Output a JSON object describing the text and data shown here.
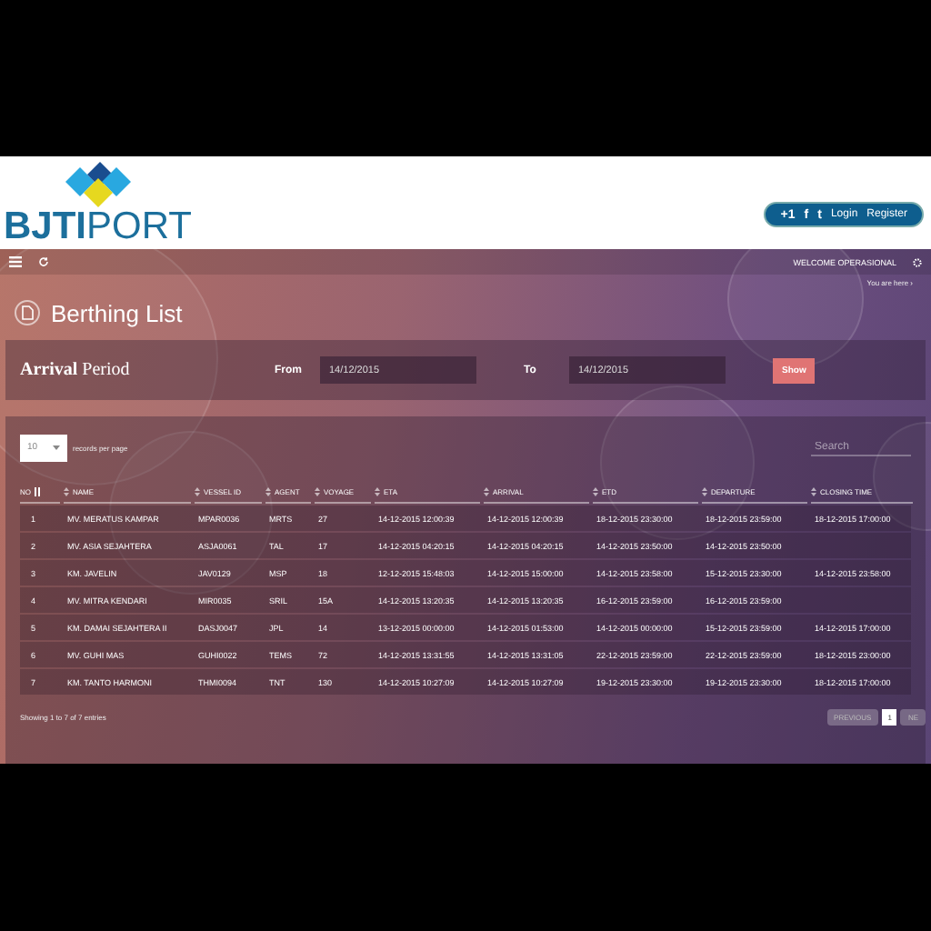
{
  "header": {
    "logo_text": "BJTI",
    "logo_text_light": "PORT",
    "social": [
      "+1",
      "f",
      "t"
    ],
    "links": [
      "Login",
      "Register"
    ]
  },
  "toolbar": {
    "welcome": "WELCOME OPERASIONAL"
  },
  "breadcrumb": {
    "label": "You are here ›"
  },
  "page_title": "Berthing List",
  "period": {
    "title_bold": "Arrival",
    "title": "Period",
    "from_label": "From",
    "from_value": "14/12/2015",
    "to_label": "To",
    "to_value": "14/12/2015",
    "button": "Show"
  },
  "table_controls": {
    "page_size": "10",
    "page_size_label": "records per page",
    "search_placeholder": "Search"
  },
  "table": {
    "columns": [
      "NO",
      "NAME",
      "VESSEL ID",
      "AGENT",
      "VOYAGE",
      "ETA",
      "ARRIVAL",
      "ETD",
      "DEPARTURE",
      "CLOSING TIME"
    ],
    "rows": [
      [
        "1",
        "MV. MERATUS KAMPAR",
        "MPAR0036",
        "MRTS",
        "27",
        "14-12-2015 12:00:39",
        "14-12-2015 12:00:39",
        "18-12-2015 23:30:00",
        "18-12-2015 23:59:00",
        "18-12-2015 17:00:00"
      ],
      [
        "2",
        "MV. ASIA SEJAHTERA",
        "ASJA0061",
        "TAL",
        "17",
        "14-12-2015 04:20:15",
        "14-12-2015 04:20:15",
        "14-12-2015 23:50:00",
        "14-12-2015 23:50:00"
      ],
      [
        "3",
        "KM. JAVELIN",
        "JAV0129",
        "MSP",
        "18",
        "12-12-2015 15:48:03",
        "14-12-2015 15:00:00",
        "14-12-2015 23:58:00",
        "15-12-2015 23:30:00",
        "14-12-2015 23:58:00"
      ],
      [
        "4",
        "MV. MITRA KENDARI",
        "MIR0035",
        "SRIL",
        "15A",
        "14-12-2015 13:20:35",
        "14-12-2015 13:20:35",
        "16-12-2015 23:59:00",
        "16-12-2015 23:59:00"
      ],
      [
        "5",
        "KM. DAMAI SEJAHTERA II",
        "DASJ0047",
        "JPL",
        "14",
        "13-12-2015 00:00:00",
        "14-12-2015 01:53:00",
        "14-12-2015 00:00:00",
        "15-12-2015 23:59:00",
        "14-12-2015 17:00:00"
      ],
      [
        "6",
        "MV. GUHI MAS",
        "GUHI0022",
        "TEMS",
        "72",
        "14-12-2015 13:31:55",
        "14-12-2015 13:31:05",
        "22-12-2015 23:59:00",
        "22-12-2015 23:59:00",
        "18-12-2015 23:00:00"
      ],
      [
        "7",
        "KM. TANTO HARMONI",
        "THMI0094",
        "TNT",
        "130",
        "14-12-2015 10:27:09",
        "14-12-2015 10:27:09",
        "19-12-2015 23:30:00",
        "19-12-2015 23:30:00",
        "18-12-2015 17:00:00"
      ]
    ]
  },
  "footer": {
    "info": "Showing 1 to 7 of 7 entries",
    "pages": [
      {
        "label": "PREVIOUS",
        "kind": "nav",
        "selected": false
      },
      {
        "label": "1",
        "kind": "page",
        "selected": true
      },
      {
        "label": "NE",
        "kind": "nav",
        "selected": false
      }
    ]
  }
}
